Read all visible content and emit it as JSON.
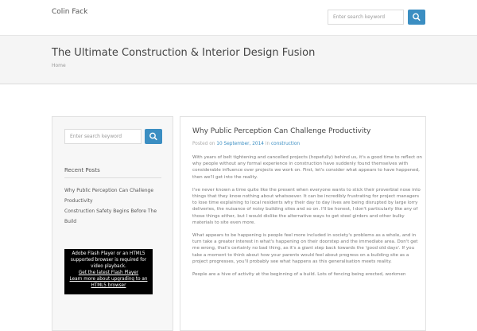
{
  "header": {
    "site_title": "Colin Fack",
    "search_placeholder": "Enter search keyword"
  },
  "hero": {
    "title": "The Ultimate Construction & Interior Design Fusion",
    "breadcrumb": "Home"
  },
  "sidebar": {
    "search_placeholder": "Enter search keyword",
    "recent_posts_heading": "Recent Posts",
    "recent_posts": [
      "Why Public Perception Can Challenge Productivity",
      "Construction Safety Begins Before The Build"
    ],
    "flash_notice": {
      "line1": "Adobe Flash Player or an HTML5 supported browser is required for video playback.",
      "link1": "Get the latest Flash Player",
      "link2": "Learn more about upgrading to an HTML5 browser"
    }
  },
  "article": {
    "title": "Why Public Perception Can Challenge Productivity",
    "meta_prefix": "Posted on",
    "date": "10 September, 2014",
    "meta_in": "in",
    "category": "construction",
    "paragraphs": [
      "With years of belt tightening and cancelled projects (hopefully) behind us, it's a good time to reflect on why people without any formal experience in construction have suddenly found themselves with considerable influence over projects we work on. First, let's consider what appears to have happened, then we'll get into the reality.",
      "I've never known a time quite like the present when everyone wants to stick their proverbial nose into things that they know nothing about whatsoever. It can be incredibly frustrating for project managers to lose time explaining to local residents why their day to day lives are being disrupted by large lorry deliveries, the nuisance of noisy building sites and so on. I'll be honest, I don't particularly like any of those things either, but I would dislike the alternative ways to get steel girders and other bulky materials to site even more.",
      "What appears to be happening is people feel more included in society's problems as a whole, and in turn take a greater interest in what's happening on their doorstep and the immediate area. Don't get me wrong, that's certainly no bad thing, as it's a giant step back towards the 'good old days'. If you take a moment to think about how your parents would feel about progress on a building site as a project progresses, you'll probably see what happens as this generalisation meets reality.",
      "People are a hive of activity at the beginning of a build. Lots of fencing being erected, workmen"
    ]
  },
  "colors": {
    "accent": "#3b8ec2",
    "hero_bg": "#f5f5f5",
    "sidebar_bg": "#f7f7f7"
  },
  "icons": {
    "search": "search-icon"
  }
}
